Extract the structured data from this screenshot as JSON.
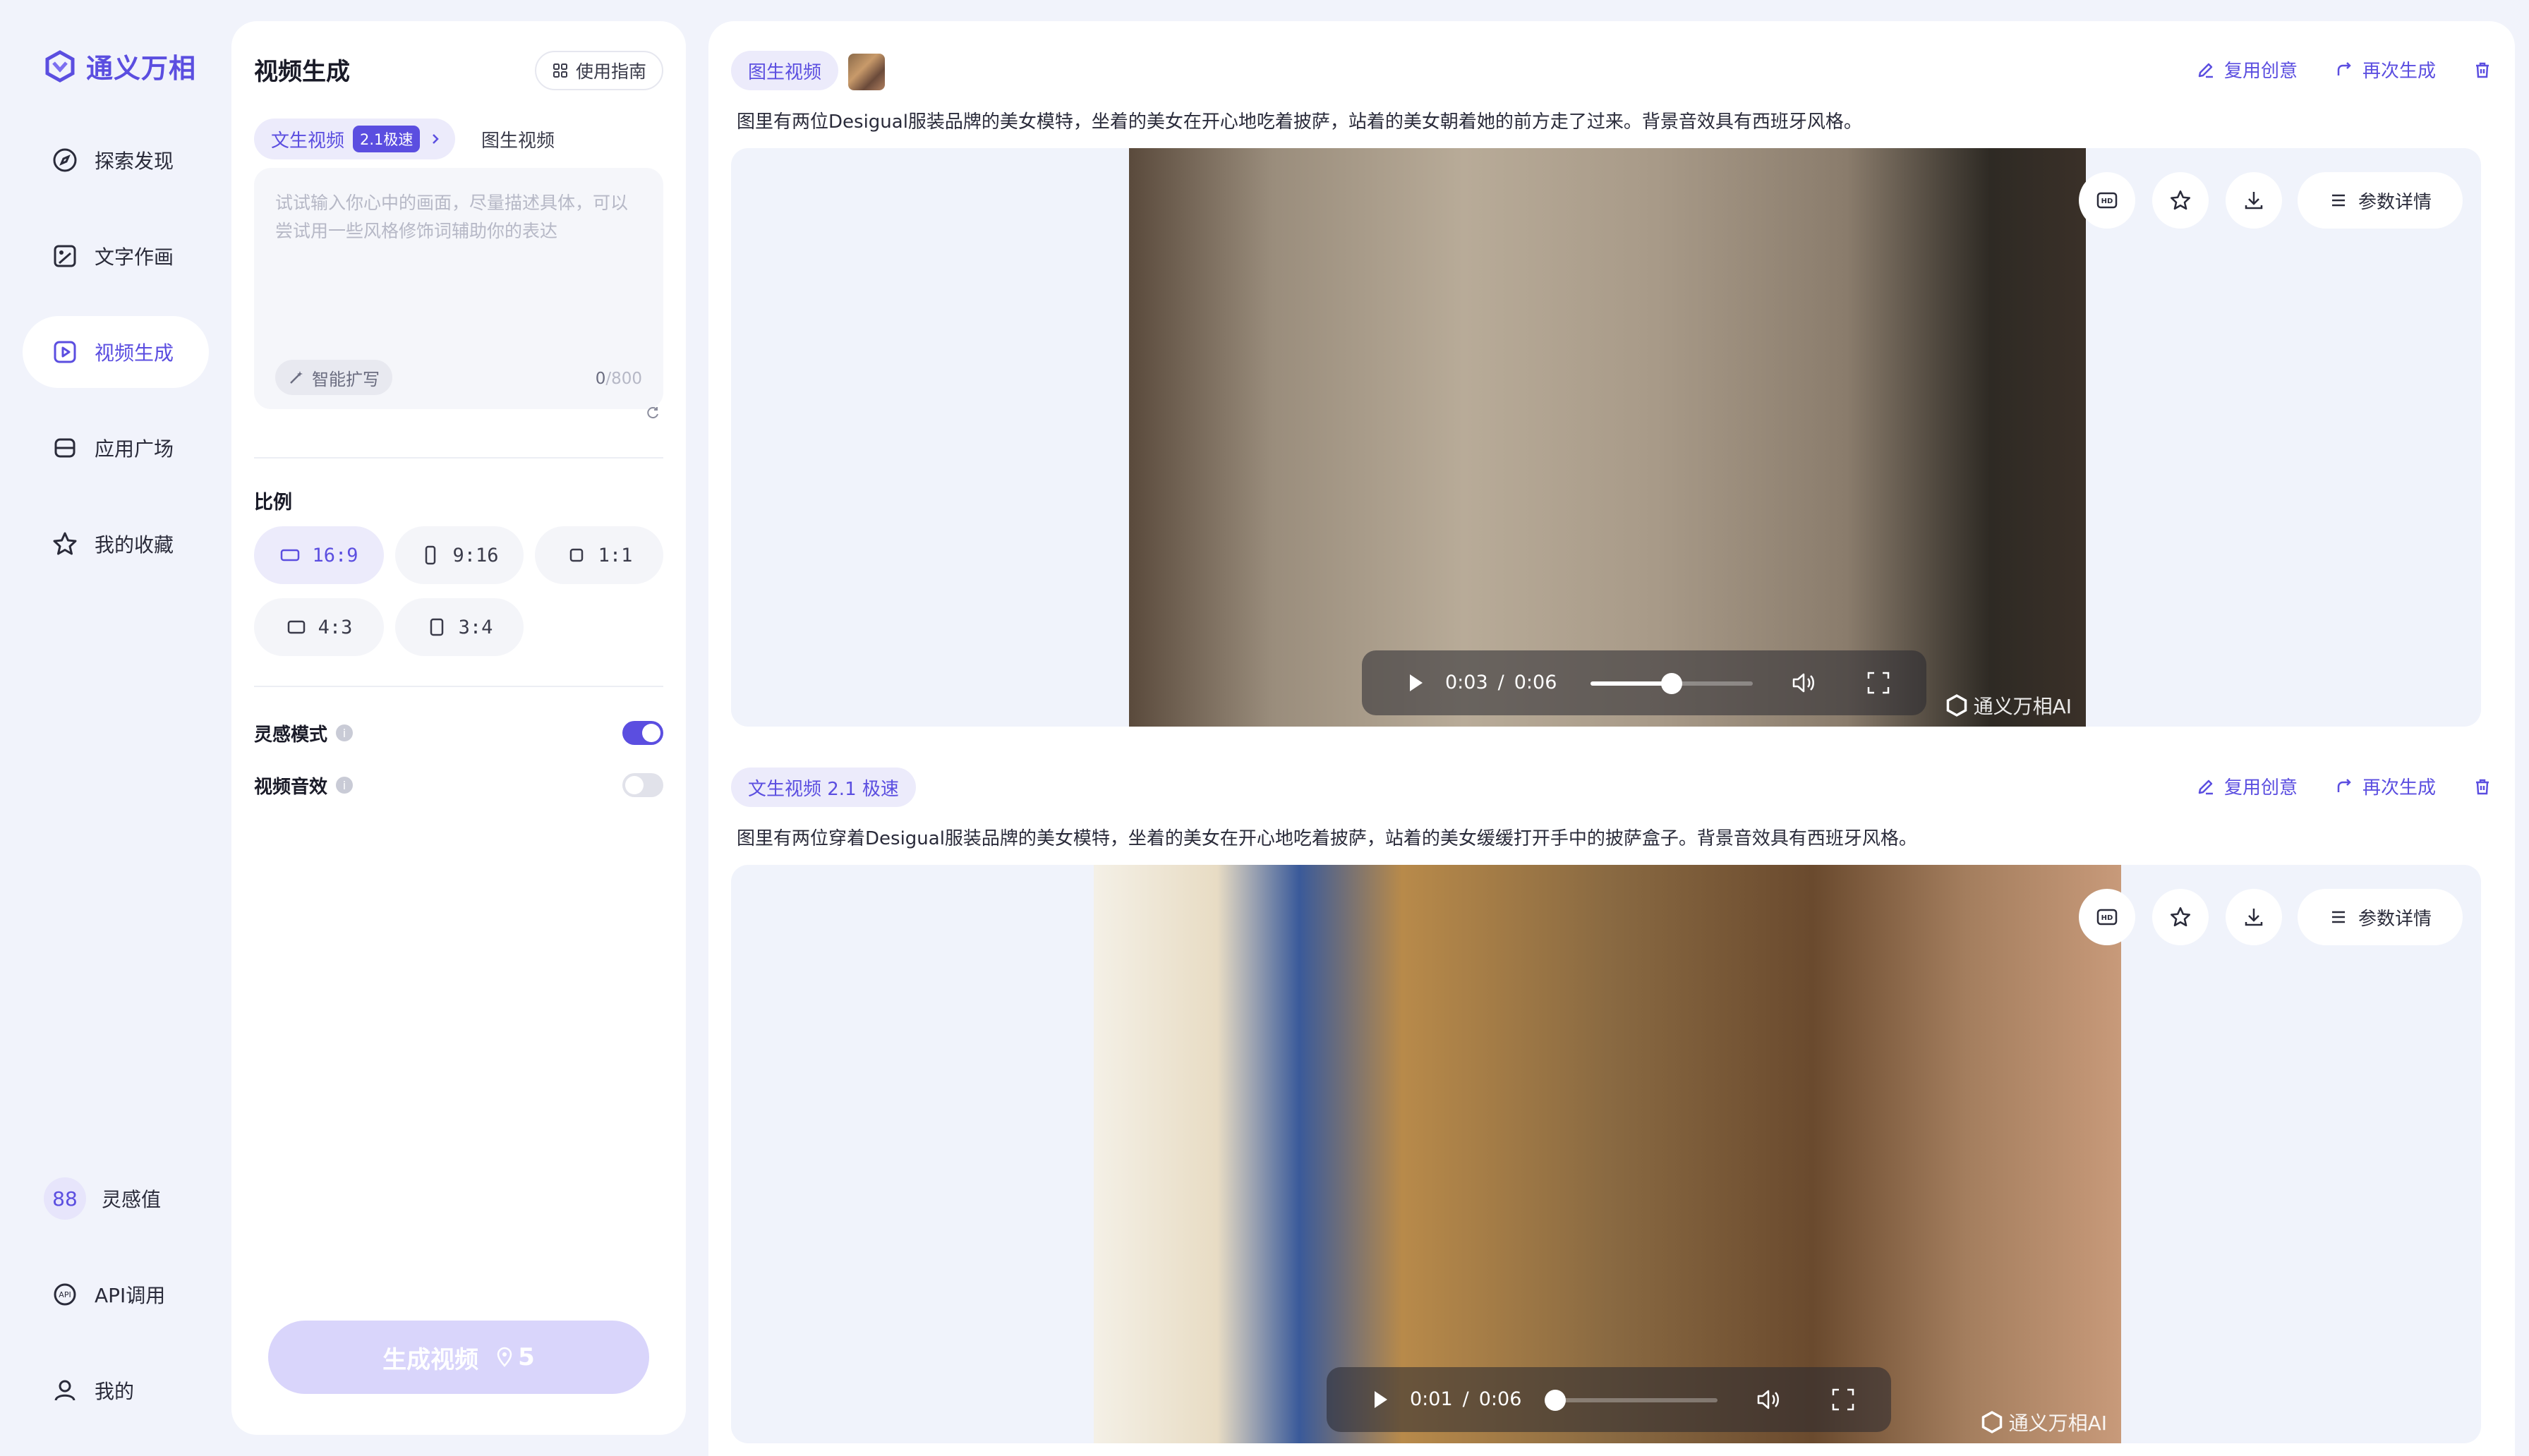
{
  "app": {
    "name": "通义万相"
  },
  "nav": {
    "items": [
      {
        "label": "探索发现",
        "icon": "compass-icon"
      },
      {
        "label": "文字作画",
        "icon": "image-edit-icon"
      },
      {
        "label": "视频生成",
        "icon": "video-icon",
        "active": true
      },
      {
        "label": "应用广场",
        "icon": "apps-icon"
      },
      {
        "label": "我的收藏",
        "icon": "star-icon"
      }
    ],
    "bottom": [
      {
        "label": "灵感值",
        "badge": "88"
      },
      {
        "label": "API调用",
        "icon": "api-icon"
      },
      {
        "label": "我的",
        "icon": "user-icon"
      }
    ]
  },
  "panel": {
    "title": "视频生成",
    "guide": "使用指南",
    "tabs": {
      "text_to_video": "文生视频",
      "speed": "2.1极速",
      "image_to_video": "图生视频"
    },
    "prompt": {
      "placeholder": "试试输入你心中的画面，尽量描述具体，可以尝试用一些风格修饰词辅助你的表达",
      "expand": "智能扩写",
      "count": "0",
      "max": "/800"
    },
    "ratio": {
      "label": "比例",
      "options": [
        "16:9",
        "9:16",
        "1:1",
        "4:3",
        "3:4"
      ],
      "selected": "16:9"
    },
    "inspiration_mode": {
      "label": "灵感模式",
      "on": true
    },
    "video_sound": {
      "label": "视频音效",
      "on": false
    },
    "generate": {
      "label": "生成视频",
      "cost": "5"
    }
  },
  "cards": [
    {
      "tag": "图生视频",
      "has_thumb": true,
      "description": "图里有两位Desigual服装品牌的美女模特，坐着的美女在开心地吃着披萨，站着的美女朝着她的前方走了过来。背景音效具有西班牙风格。",
      "actions": {
        "reuse": "复用创意",
        "regenerate": "再次生成"
      },
      "params": "参数详情",
      "player": {
        "current": "0:03",
        "duration": "0:06",
        "progress": 0.5
      },
      "watermark": "通义万相AI"
    },
    {
      "tag": "文生视频 2.1 极速",
      "has_thumb": false,
      "description": "图里有两位穿着Desigual服装品牌的美女模特，坐着的美女在开心地吃着披萨，站着的美女缓缓打开手中的披萨盒子。背景音效具有西班牙风格。",
      "actions": {
        "reuse": "复用创意",
        "regenerate": "再次生成"
      },
      "params": "参数详情",
      "player": {
        "current": "0:01",
        "duration": "0:06",
        "progress": 0.0
      },
      "watermark": "通义万相AI"
    }
  ],
  "colors": {
    "accent": "#5b4ee0",
    "accent_light": "#ecebfb",
    "background": "#f1f3fb"
  }
}
